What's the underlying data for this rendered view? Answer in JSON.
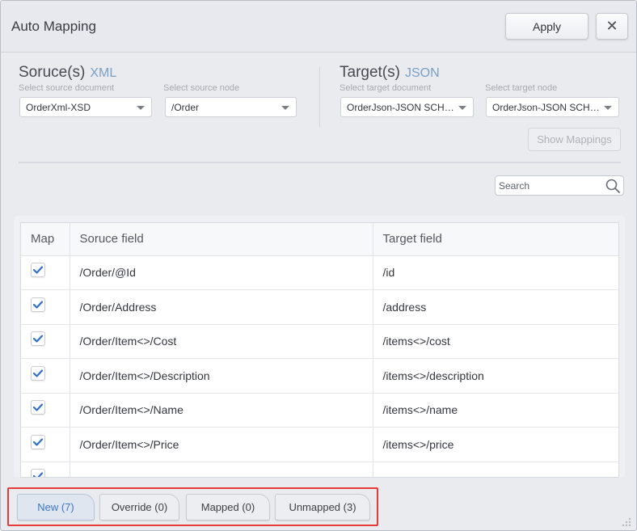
{
  "dialog": {
    "title": "Auto Mapping",
    "apply_label": "Apply",
    "close_label": "✕"
  },
  "source": {
    "title": "Soruce(s)",
    "type": "XML",
    "document_label": "Select source document",
    "document_value": "OrderXml-XSD",
    "node_label": "Select source node",
    "node_value": "/Order"
  },
  "target": {
    "title": "Target(s)",
    "type": "JSON",
    "document_label": "Select target document",
    "document_value": "OrderJson-JSON SCHE...",
    "node_label": "Select target node",
    "node_value": "OrderJson-JSON SCHE..."
  },
  "show_mappings_label": "Show Mappings",
  "search": {
    "placeholder": "Search"
  },
  "table": {
    "columns": [
      "Map",
      "Soruce field",
      "Target field"
    ],
    "rows": [
      {
        "checked": true,
        "source": "/Order/@Id",
        "target": "/id"
      },
      {
        "checked": true,
        "source": "/Order/Address",
        "target": "/address"
      },
      {
        "checked": true,
        "source": "/Order/Item<>/Cost",
        "target": "/items<>/cost"
      },
      {
        "checked": true,
        "source": "/Order/Item<>/Description",
        "target": "/items<>/description"
      },
      {
        "checked": true,
        "source": "/Order/Item<>/Name",
        "target": "/items<>/name"
      },
      {
        "checked": true,
        "source": "/Order/Item<>/Price",
        "target": "/items<>/price"
      },
      {
        "checked": true,
        "source": "",
        "target": ""
      }
    ]
  },
  "tabs": [
    {
      "label": "New (7)",
      "active": true
    },
    {
      "label": "Override (0)",
      "active": false
    },
    {
      "label": "Mapped (0)",
      "active": false
    },
    {
      "label": "Unmapped (3)",
      "active": false
    }
  ],
  "colors": {
    "accent": "#3b76c5",
    "checkmark": "#2f6fd0",
    "highlight": "#e53a3a",
    "type_label": "#7aa0c6"
  }
}
